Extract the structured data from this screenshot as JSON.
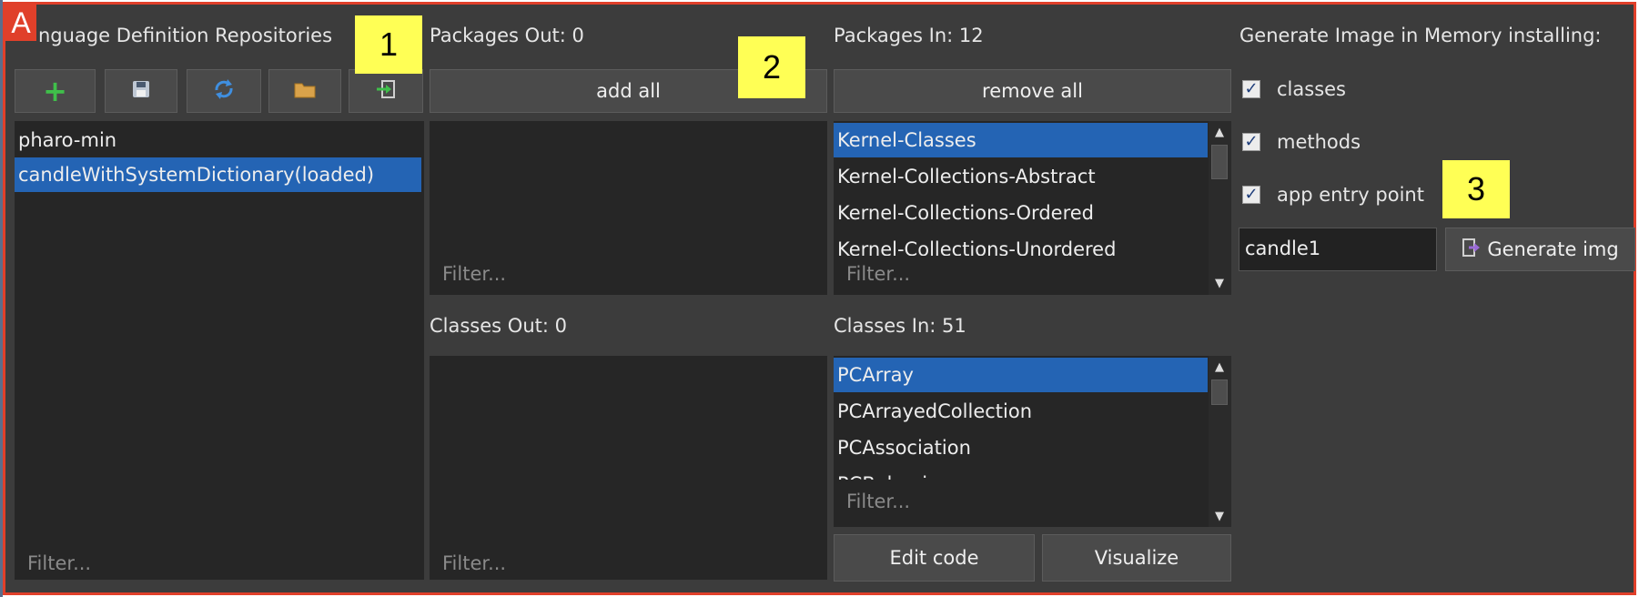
{
  "frame_marker": "A",
  "repositories": {
    "title": "nguage Definition Repositories",
    "toolbar": {
      "add_icon": "plus-icon",
      "save_icon": "floppy-disk-icon",
      "refresh_icon": "refresh-icon",
      "folder_icon": "folder-icon",
      "import_icon": "import-icon"
    },
    "items": [
      {
        "label": "pharo-min",
        "selected": false
      },
      {
        "label": "candleWithSystemDictionary(loaded)",
        "selected": true
      }
    ],
    "filter_placeholder": "Filter..."
  },
  "packages_out": {
    "title": "Packages Out: 0",
    "add_all": "add all",
    "filter_placeholder": "Filter..."
  },
  "packages_in": {
    "title": "Packages In: 12",
    "remove_all": "remove all",
    "items": [
      {
        "label": "Kernel-Classes",
        "selected": true
      },
      {
        "label": "Kernel-Collections-Abstract",
        "selected": false
      },
      {
        "label": "Kernel-Collections-Ordered",
        "selected": false
      },
      {
        "label": "Kernel-Collections-Unordered",
        "selected": false
      }
    ],
    "filter_placeholder": "Filter..."
  },
  "classes_out": {
    "title": "Classes Out: 0",
    "filter_placeholder": "Filter..."
  },
  "classes_in": {
    "title": "Classes In: 51",
    "items": [
      {
        "label": "PCArray",
        "selected": true
      },
      {
        "label": "PCArrayedCollection",
        "selected": false
      },
      {
        "label": "PCAssociation",
        "selected": false
      },
      {
        "label": "PCBehavior",
        "selected": false
      }
    ],
    "filter_placeholder": "Filter...",
    "edit_code": "Edit code",
    "visualize": "Visualize"
  },
  "generate": {
    "title": "Generate Image in Memory installing:",
    "options": [
      {
        "label": "classes",
        "checked": true
      },
      {
        "label": "methods",
        "checked": true
      },
      {
        "label": "app entry point",
        "checked": true
      }
    ],
    "name_value": "candle1",
    "button": "Generate img"
  },
  "annotations": [
    "1",
    "2",
    "3"
  ],
  "colors": {
    "background": "#3c3c3c",
    "list_background": "#262626",
    "selection": "#2464b4",
    "frame_border": "#e0402a",
    "callout": "#ffff55"
  }
}
